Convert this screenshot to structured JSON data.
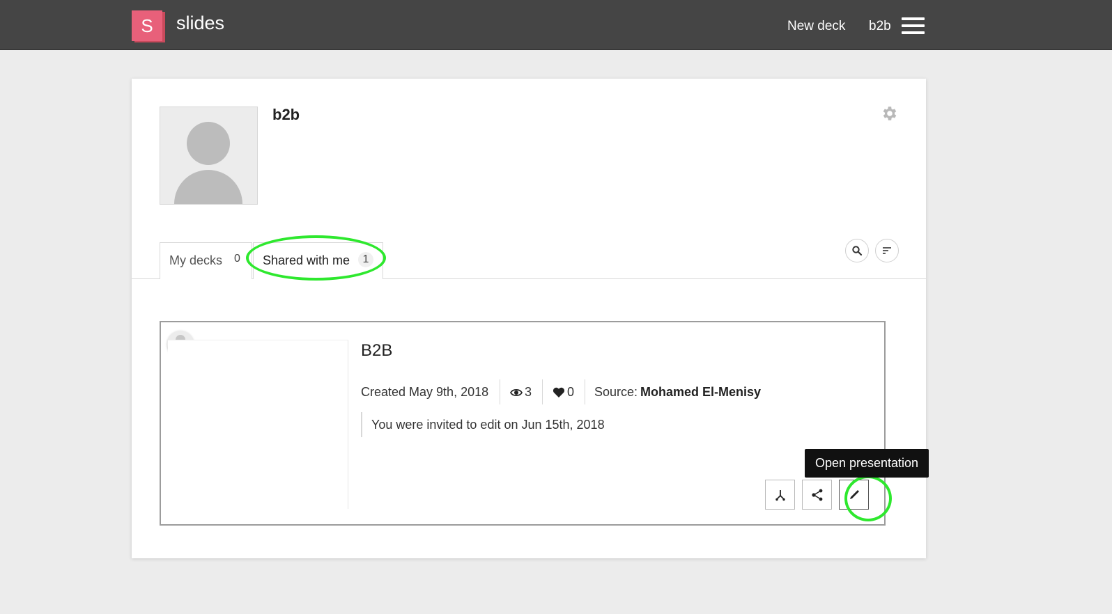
{
  "header": {
    "logo_letter": "S",
    "brand": "slides",
    "new_deck_label": "New deck",
    "user_label": "b2b"
  },
  "profile": {
    "username": "b2b"
  },
  "tabs": [
    {
      "label": "My decks",
      "count": "0"
    },
    {
      "label": "Shared with me",
      "count": "1"
    }
  ],
  "deck": {
    "title": "B2B",
    "created": "Created May 9th, 2018",
    "views": "3",
    "likes": "0",
    "source_label": "Source:",
    "source_name": "Mohamed El-Menisy",
    "invited": "You were invited to edit on Jun 15th, 2018"
  },
  "tooltip": "Open presentation",
  "colors": {
    "topbar": "#454545",
    "logo": "#e8607a",
    "annotation": "#2ee82e"
  }
}
